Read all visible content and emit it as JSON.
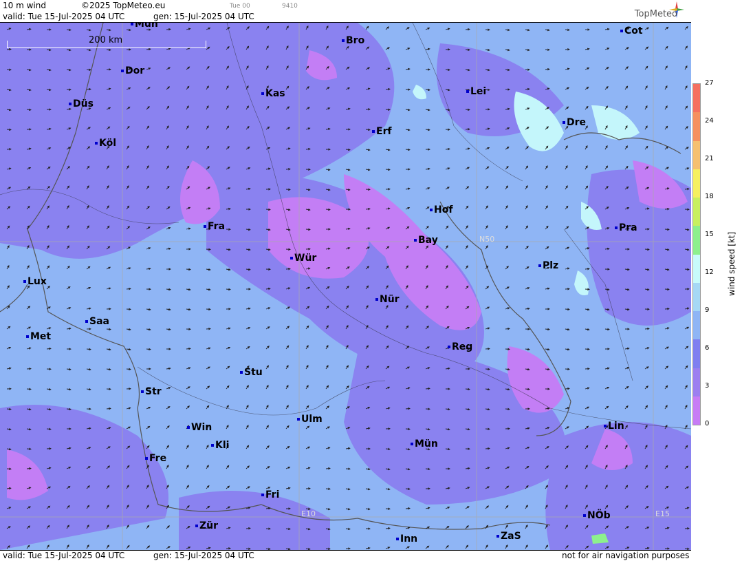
{
  "header": {
    "field": "10 m wind",
    "copyright": "©2025 TopMeteo.eu",
    "time_short": "Tue 00",
    "code": "9410",
    "valid": "valid:  Tue  15-Jul-2025  04 UTC",
    "gen": "gen: 15-Jul-2025 04 UTC",
    "logo_text": "TopMeteo"
  },
  "footer": {
    "valid": "valid:  Tue  15-Jul-2025  04 UTC",
    "gen": "gen: 15-Jul-2025 04 UTC",
    "disclaimer": "not for air navigation purposes"
  },
  "scale_bar": "200 km",
  "grid_labels": [
    "N50",
    "E10",
    "E15"
  ],
  "legend": {
    "label": "wind speed [kt]",
    "ticks": [
      "27",
      "24",
      "21",
      "18",
      "15",
      "12",
      "9",
      "6",
      "3",
      "0"
    ],
    "colors": [
      "#c77cf5",
      "#9c7ff0",
      "#7f7ff0",
      "#8fb5f5",
      "#a6d8f5",
      "#c8fbfb",
      "#8df08d",
      "#c8f060",
      "#f5f060",
      "#f5c070",
      "#f59060",
      "#f57060"
    ]
  },
  "cities": [
    {
      "name": "Mün",
      "id": "mun-top"
    },
    {
      "name": "Bro"
    },
    {
      "name": "Cot"
    },
    {
      "name": "Dor"
    },
    {
      "name": "Kas"
    },
    {
      "name": "Lei"
    },
    {
      "name": "Düs"
    },
    {
      "name": "Dre"
    },
    {
      "name": "Erf"
    },
    {
      "name": "Köl"
    },
    {
      "name": "Hof"
    },
    {
      "name": "Fra"
    },
    {
      "name": "Pra"
    },
    {
      "name": "Bay"
    },
    {
      "name": "Wür"
    },
    {
      "name": "Plz"
    },
    {
      "name": "Lux"
    },
    {
      "name": "Nür"
    },
    {
      "name": "Saa"
    },
    {
      "name": "Met"
    },
    {
      "name": "Reg"
    },
    {
      "name": "Stu"
    },
    {
      "name": "Str"
    },
    {
      "name": "Ulm"
    },
    {
      "name": "Lin"
    },
    {
      "name": "Win"
    },
    {
      "name": "Mün"
    },
    {
      "name": "Kli"
    },
    {
      "name": "Fre"
    },
    {
      "name": "Fri"
    },
    {
      "name": "NÖb"
    },
    {
      "name": "Zür"
    },
    {
      "name": "Inn"
    },
    {
      "name": "ZaS"
    }
  ]
}
